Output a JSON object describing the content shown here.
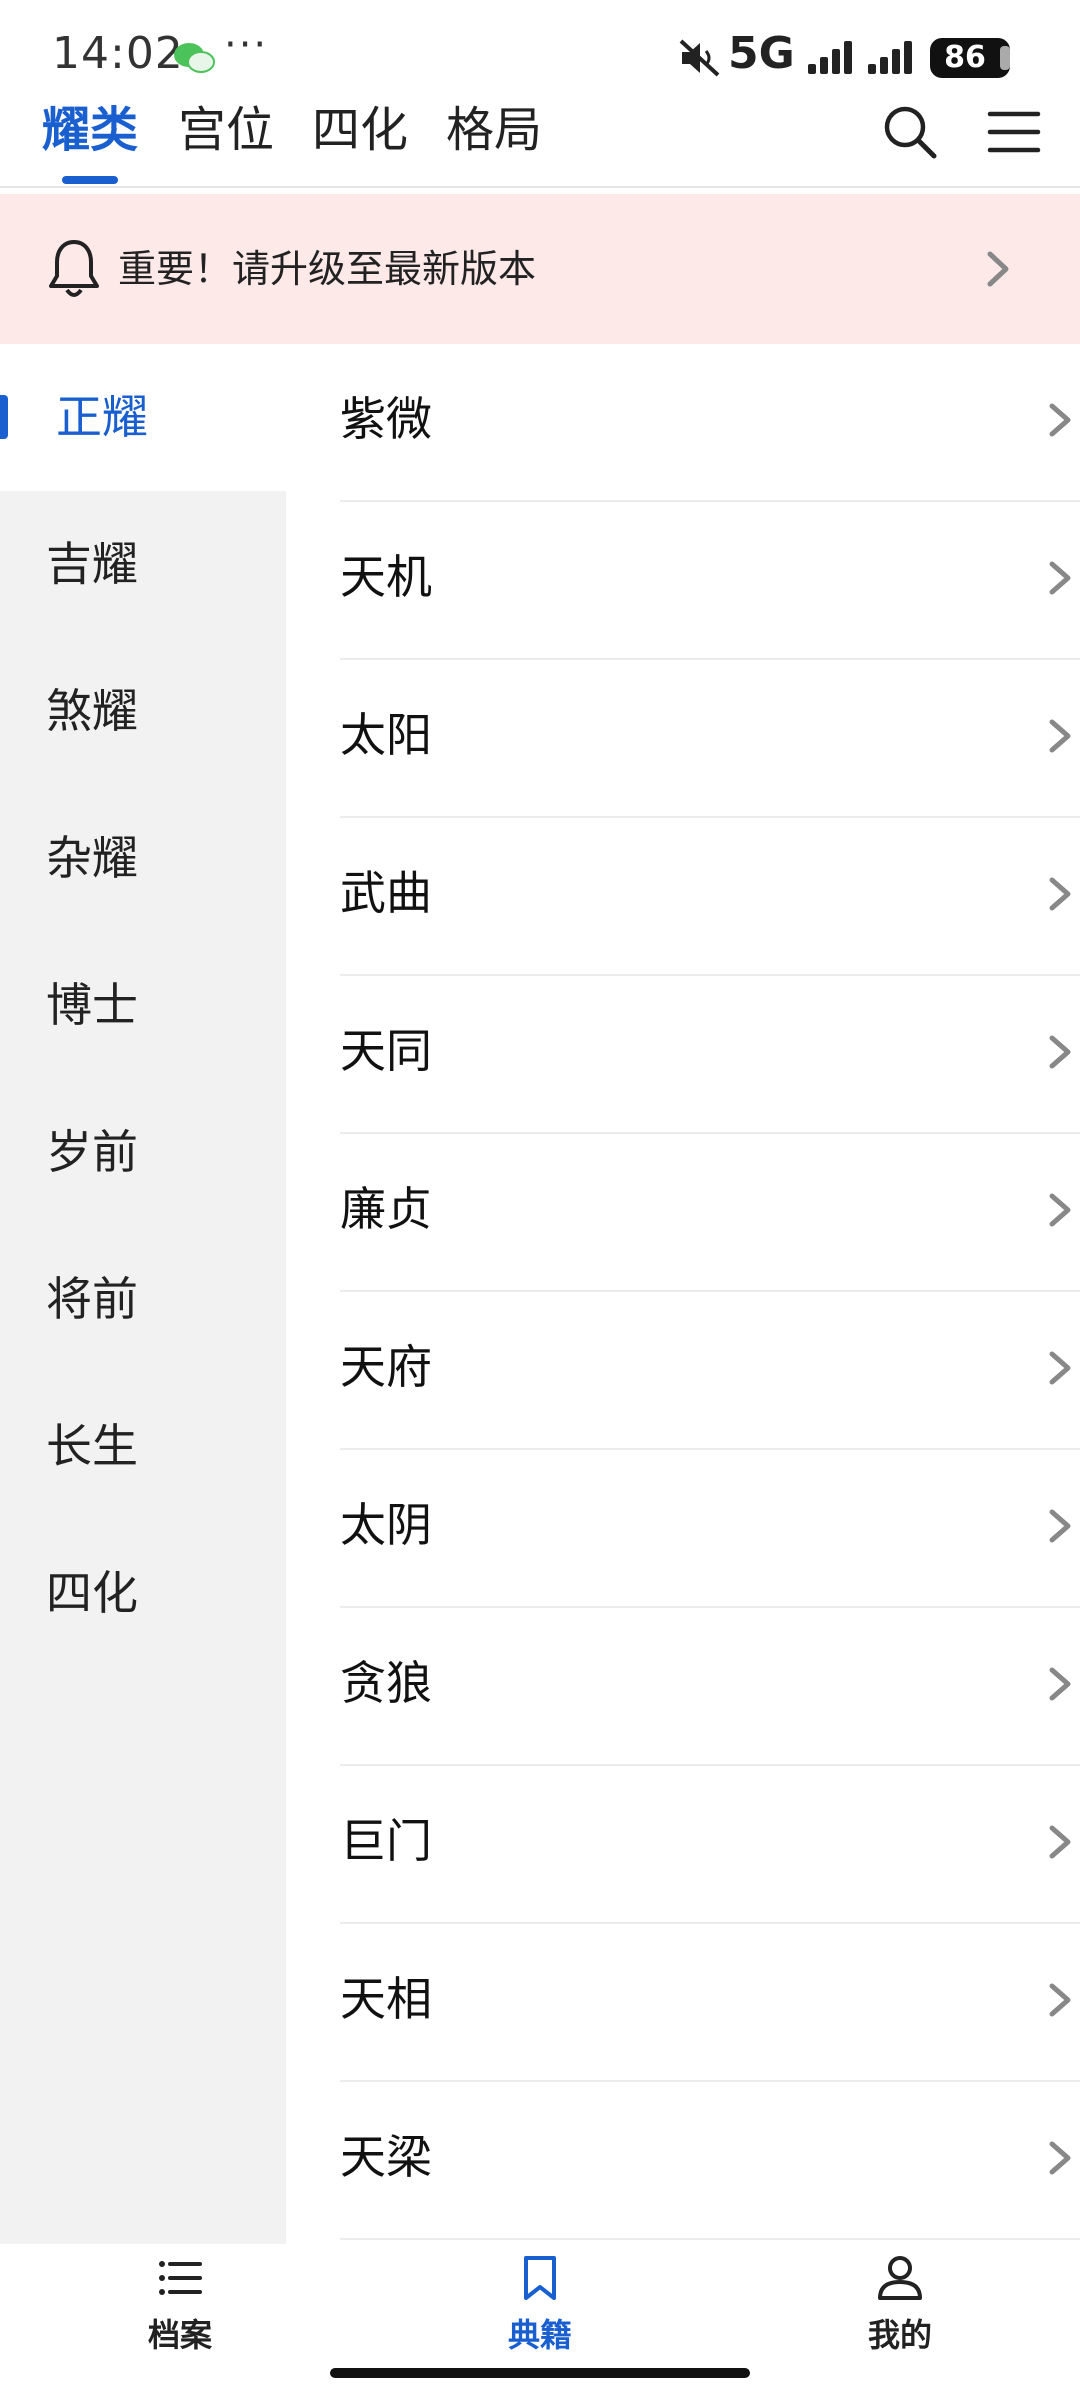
{
  "status_bar": {
    "time": "14:02",
    "more": "···",
    "network": "5G",
    "battery": "86"
  },
  "top_tabs": [
    {
      "label": "耀类",
      "active": true
    },
    {
      "label": "宫位",
      "active": false
    },
    {
      "label": "四化",
      "active": false
    },
    {
      "label": "格局",
      "active": false
    }
  ],
  "banner": {
    "text": "重要！请升级至最新版本"
  },
  "sidebar": {
    "items": [
      {
        "label": "正耀",
        "active": true
      },
      {
        "label": "吉耀"
      },
      {
        "label": "煞耀"
      },
      {
        "label": "杂耀"
      },
      {
        "label": "博士"
      },
      {
        "label": "岁前"
      },
      {
        "label": "将前"
      },
      {
        "label": "长生"
      },
      {
        "label": "四化"
      }
    ]
  },
  "list": {
    "items": [
      {
        "label": "紫微"
      },
      {
        "label": "天机"
      },
      {
        "label": "太阳"
      },
      {
        "label": "武曲"
      },
      {
        "label": "天同"
      },
      {
        "label": "廉贞"
      },
      {
        "label": "天府"
      },
      {
        "label": "太阴"
      },
      {
        "label": "贪狼"
      },
      {
        "label": "巨门"
      },
      {
        "label": "天相"
      },
      {
        "label": "天梁"
      }
    ]
  },
  "bottom_nav": {
    "items": [
      {
        "label": "档案",
        "icon": "list-icon"
      },
      {
        "label": "典籍",
        "icon": "bookmark-icon",
        "active": true
      },
      {
        "label": "我的",
        "icon": "user-icon"
      }
    ]
  },
  "colors": {
    "accent": "#1a5fcf",
    "banner_bg": "#fde9e8",
    "sidebar_bg": "#f2f2f2"
  }
}
